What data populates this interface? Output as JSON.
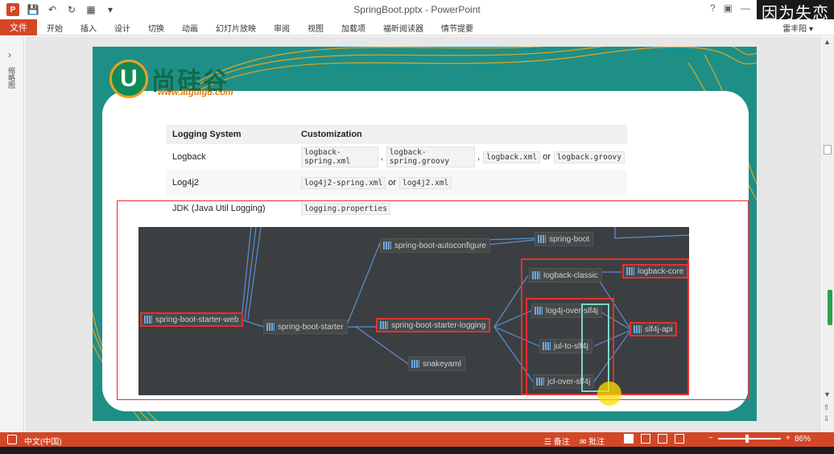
{
  "window": {
    "title": "SpringBoot.pptx - PowerPoint",
    "user": "雷丰阳",
    "watermark": "因为失恋"
  },
  "ribbon": {
    "file": "文件",
    "tabs": [
      "开始",
      "插入",
      "设计",
      "切换",
      "动画",
      "幻灯片放映",
      "审阅",
      "视图",
      "加载项",
      "福昕阅读器",
      "情节提要"
    ]
  },
  "leftpane": {
    "label": "缩略图"
  },
  "slide": {
    "logo_text": "尚硅谷",
    "logo_url": "www.atguigu.com",
    "table": {
      "headers": [
        "Logging System",
        "Customization"
      ],
      "rows": [
        {
          "system": "Logback",
          "files": [
            "logback-spring.xml",
            "logback-spring.groovy",
            "logback.xml",
            "logback.groovy"
          ],
          "seps": [
            ",",
            ",",
            "or"
          ]
        },
        {
          "system": "Log4j2",
          "files": [
            "log4j2-spring.xml",
            "log4j2.xml"
          ],
          "seps": [
            "or"
          ]
        },
        {
          "system": "JDK (Java Util Logging)",
          "files": [
            "logging.properties"
          ],
          "seps": []
        }
      ]
    },
    "graph": {
      "nodes": {
        "web": "spring-boot-starter-web",
        "starter": "spring-boot-starter",
        "autoconfigure": "spring-boot-autoconfigure",
        "boot": "spring-boot",
        "logging": "spring-boot-starter-logging",
        "snakeyaml": "snakeyaml",
        "logback_classic": "logback-classic",
        "logback_core": "logback-core",
        "log4j_over": "log4j-over-slf4j",
        "jul": "jul-to-slf4j",
        "jcl": "jcl-over-slf4j",
        "slf4j": "slf4j-api"
      }
    }
  },
  "status": {
    "language": "中文(中国)",
    "notes": "备注",
    "comments": "批注",
    "zoom": "86%"
  }
}
